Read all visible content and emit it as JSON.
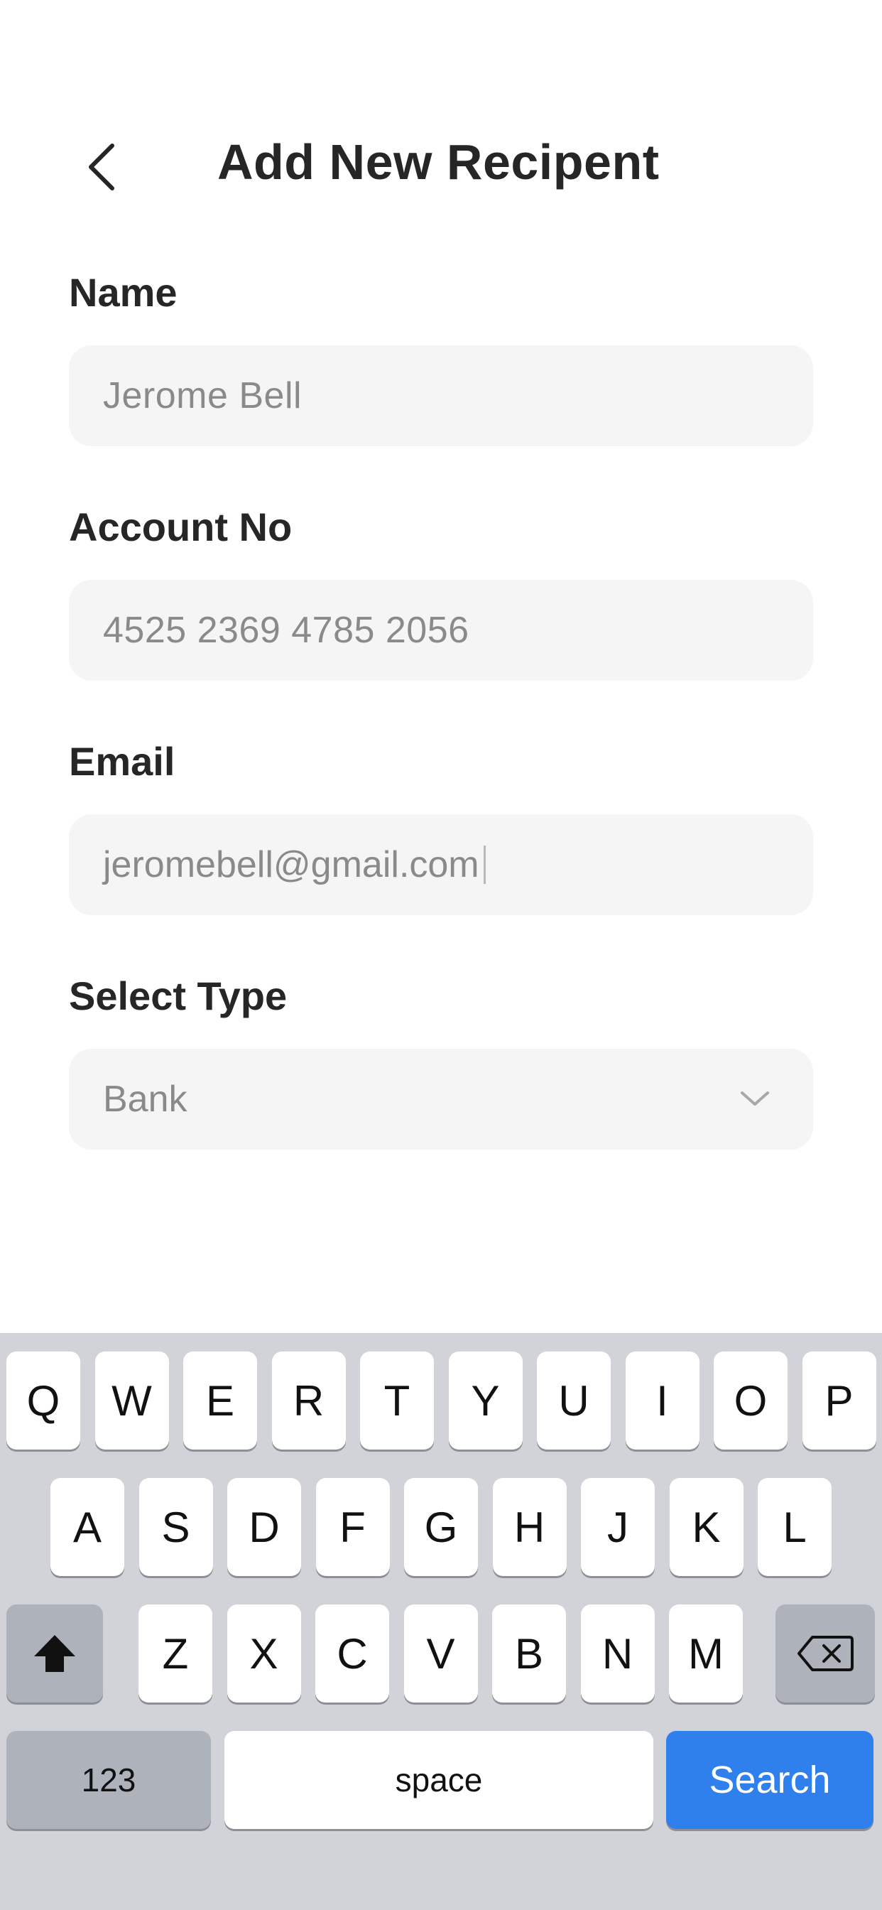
{
  "header": {
    "back_icon": "chevron-left-icon",
    "title": "Add New Recipent"
  },
  "form": {
    "name": {
      "label": "Name",
      "value": "Jerome Bell"
    },
    "account": {
      "label": "Account No",
      "value": "4525 2369 4785 2056"
    },
    "email": {
      "label": "Email",
      "value": "jeromebell@gmail.com"
    },
    "type": {
      "label": "Select Type",
      "selected": "Bank",
      "icon": "chevron-down-icon"
    }
  },
  "keyboard": {
    "row1": [
      "Q",
      "W",
      "E",
      "R",
      "T",
      "Y",
      "U",
      "I",
      "O",
      "P"
    ],
    "row2": [
      "A",
      "S",
      "D",
      "F",
      "G",
      "H",
      "J",
      "K",
      "L"
    ],
    "row3": [
      "Z",
      "X",
      "C",
      "V",
      "B",
      "N",
      "M"
    ],
    "shift_icon": "shift-icon",
    "delete_icon": "delete-icon",
    "numbers_label": "123",
    "space_label": "space",
    "action_label": "Search",
    "action_color": "#2f80ed"
  }
}
